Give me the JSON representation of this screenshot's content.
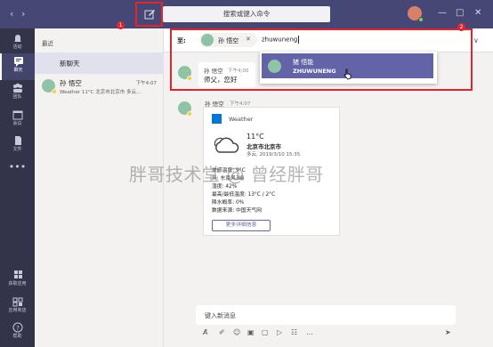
{
  "titlebar": {
    "search_placeholder": "搜索或键入命令",
    "back_icon": "chevron-left-icon",
    "forward_icon": "chevron-right-icon",
    "compose_icon": "new-chat-icon"
  },
  "rail": {
    "items": [
      {
        "label": "活动",
        "icon": "bell-icon"
      },
      {
        "label": "聊天",
        "icon": "chat-icon"
      },
      {
        "label": "团队",
        "icon": "teams-icon"
      },
      {
        "label": "会议",
        "icon": "calendar-icon"
      },
      {
        "label": "文件",
        "icon": "file-icon"
      },
      {
        "label": "获取应用",
        "icon": "apps-icon"
      },
      {
        "label": "应用商店",
        "icon": "store-icon"
      },
      {
        "label": "帮助",
        "icon": "help-icon"
      }
    ]
  },
  "chat_list": {
    "section": "最近",
    "new_chat": "新聊天",
    "rows": [
      {
        "name": "孙 悟空",
        "time": "下午4:07",
        "preview": "Weather 11°C 北京市北京市 多云..."
      }
    ]
  },
  "compose_to": {
    "to_label": "至:",
    "chip_name": "孙 悟空",
    "typed": "zhuwuneng"
  },
  "suggestion": {
    "name": "猪 悟能",
    "sub": "ZHUWUNENG"
  },
  "messages": [
    {
      "sender": "孙 悟空",
      "time": "下午4:00",
      "text": "师父，您好"
    },
    {
      "sender": "孙 悟空",
      "time": "下午4:07"
    }
  ],
  "weather_card": {
    "app": "Weather",
    "temp": "11°C",
    "city": "北京市北京市",
    "condition": "多云, 2019/3/10 15:35",
    "details": [
      "体感温度: 9°C",
      "风: 东南风3级",
      "湿度: 42%",
      "最高/最低温度: 13°C / 2°C",
      "降水概率: 0%",
      "数据来源: 中国天气网"
    ],
    "button": "更多详细信息"
  },
  "compose": {
    "placeholder": "键入新消息"
  },
  "annotations": [
    "1",
    "2"
  ],
  "watermark": "胖哥技术堂 @ 曾经胖哥",
  "colors": {
    "titlebar": "#464775",
    "rail": "#33344a",
    "accent": "#6264a7",
    "annotation_red": "#e0262d"
  }
}
